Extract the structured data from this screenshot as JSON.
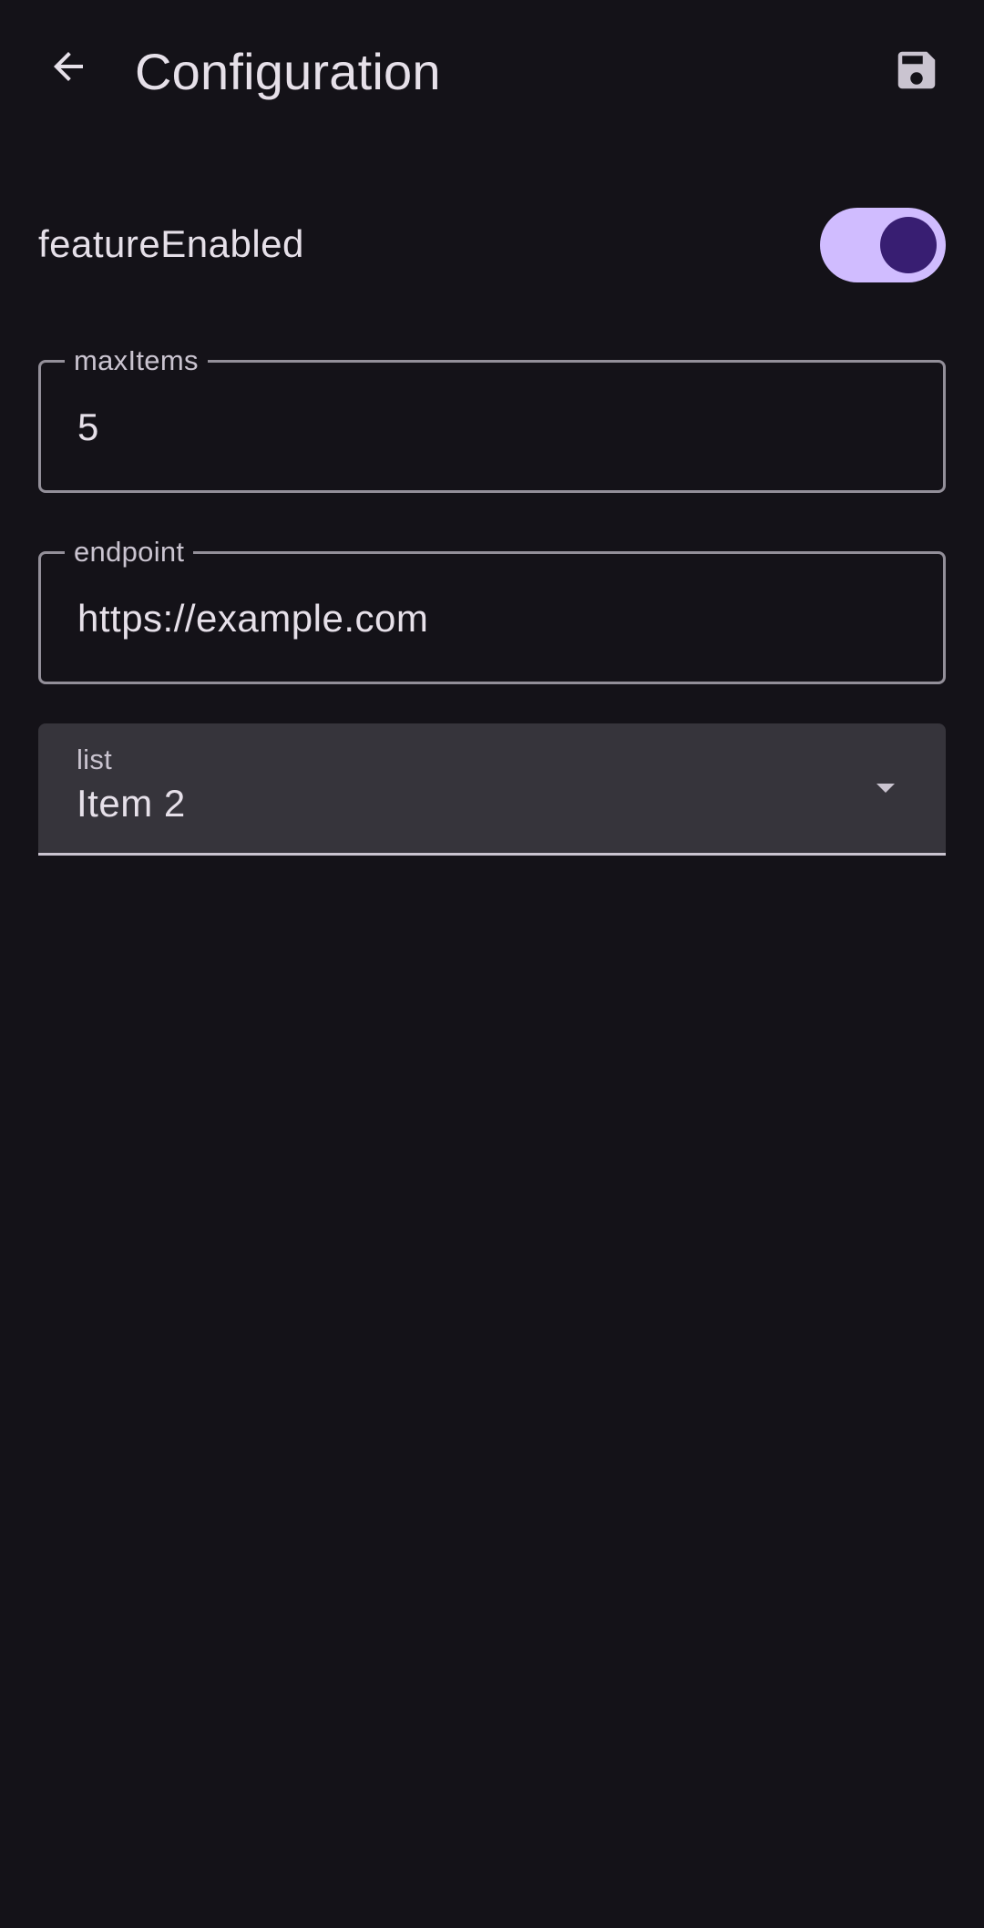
{
  "header": {
    "title": "Configuration",
    "back_icon": "arrow-back-icon",
    "save_icon": "save-icon"
  },
  "form": {
    "feature_enabled": {
      "label": "featureEnabled",
      "checked": true
    },
    "max_items": {
      "label": "maxItems",
      "value": "5"
    },
    "endpoint": {
      "label": "endpoint",
      "value": "https://example.com"
    },
    "list": {
      "label": "list",
      "selected": "Item 2",
      "icon": "arrow-drop-down-icon"
    }
  },
  "colors": {
    "background": "#141218",
    "on_surface": "#e6e0e9",
    "primary": "#d0bcff",
    "on_primary": "#381e72",
    "outline": "#938f99",
    "surface_container_highest": "#36343b"
  }
}
